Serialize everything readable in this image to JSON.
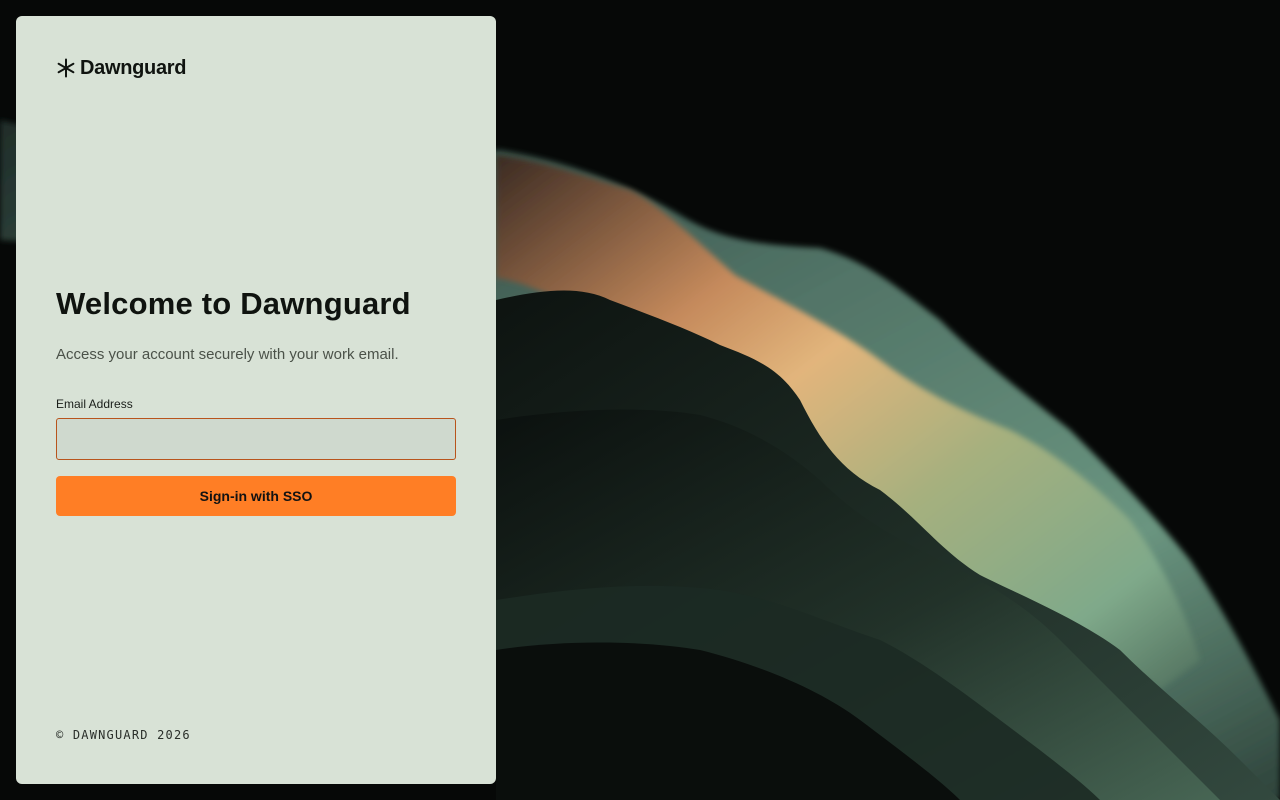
{
  "brand": {
    "name": "Dawnguard",
    "logo_icon": "asterisk-icon"
  },
  "login": {
    "title": "Welcome to Dawnguard",
    "subtitle": "Access your account securely with your work email.",
    "email_label": "Email Address",
    "email_value": "",
    "email_placeholder": "",
    "sso_button_label": "Sign-in with SSO"
  },
  "footer": {
    "copyright": "© DAWNGUARD 2026"
  },
  "colors": {
    "panel_bg": "#d8e2d6",
    "accent": "#ff7e25",
    "input_border": "#b8541c",
    "text_dark": "#0f130f"
  }
}
